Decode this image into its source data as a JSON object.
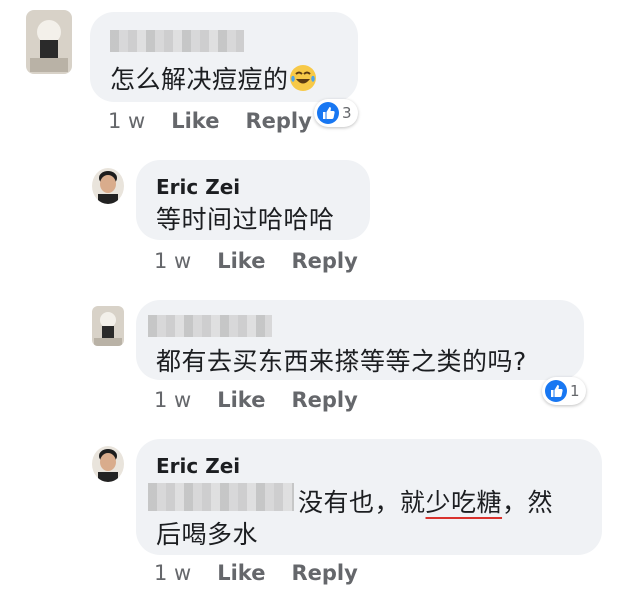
{
  "comments": [
    {
      "author": "",
      "text": "怎么解决痘痘的",
      "emoji": "laughing-tears-emoji",
      "time": "1 w",
      "like_label": "Like",
      "reply_label": "Reply",
      "reactions": "3"
    },
    {
      "author": "Eric Zei",
      "text": "等时间过哈哈哈",
      "time": "1 w",
      "like_label": "Like",
      "reply_label": "Reply"
    },
    {
      "author": "",
      "text": "都有去买东西来搽等等之类的吗?",
      "time": "1 w",
      "like_label": "Like",
      "reply_label": "Reply",
      "reactions": "1"
    },
    {
      "author": "Eric Zei",
      "text_line1_a": "没有也，就",
      "text_line1_b": "少吃糖",
      "text_line1_c": "，然",
      "text_line2": "后喝多水",
      "time": "1 w",
      "like_label": "Like",
      "reply_label": "Reply"
    }
  ],
  "colors": {
    "bubble": "#f0f2f5",
    "meta_text": "#65676b",
    "like_blue": "#1877f2",
    "underline": "#d9322d"
  }
}
